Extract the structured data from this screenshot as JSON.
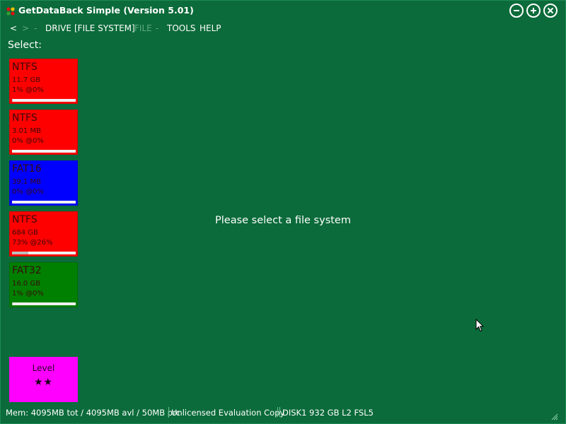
{
  "window": {
    "title": "GetDataBack Simple (Version 5.01)",
    "controls": [
      "minimize-icon",
      "maximize-icon",
      "close-icon"
    ]
  },
  "menu": {
    "back": "<",
    "forward": ">",
    "sep1": "-",
    "drive": "DRIVE",
    "file_system": "[FILE SYSTEM]",
    "file": "FILE",
    "sep2": "-",
    "tools": "TOOLS",
    "help": "HELP"
  },
  "select_label": "Select:",
  "file_systems": [
    {
      "type": "NTFS",
      "size": "11.7 GB",
      "progress": "1% @0%",
      "color": "#ff0000",
      "bar_fill": 0.01
    },
    {
      "type": "NTFS",
      "size": "3.01 MB",
      "progress": "0% @0%",
      "color": "#ff0000",
      "bar_fill": 0.0
    },
    {
      "type": "FAT16",
      "size": "39.1 MB",
      "progress": "0% @0%",
      "color": "#0000ff",
      "bar_fill": 0.0
    },
    {
      "type": "NTFS",
      "size": "684 GB",
      "progress": "73% @26%",
      "color": "#ff0000",
      "bar_fill": 0.26
    },
    {
      "type": "FAT32",
      "size": "16.0 GB",
      "progress": "1% @0%",
      "color": "#008000",
      "bar_fill": 0.01
    }
  ],
  "center_message": "Please select a file system",
  "level": {
    "label": "Level",
    "stars": "★★",
    "color": "#ff00ff"
  },
  "status": {
    "memory": "Mem: 4095MB tot / 4095MB avl / 50MB prc",
    "license": "Unlicensed Evaluation Copy",
    "disk": "DISK1 932 GB L2 FSL5"
  },
  "colors": {
    "background": "#0b6b3a",
    "text": "#ffffff",
    "disabled_text": "#5fa97f"
  }
}
